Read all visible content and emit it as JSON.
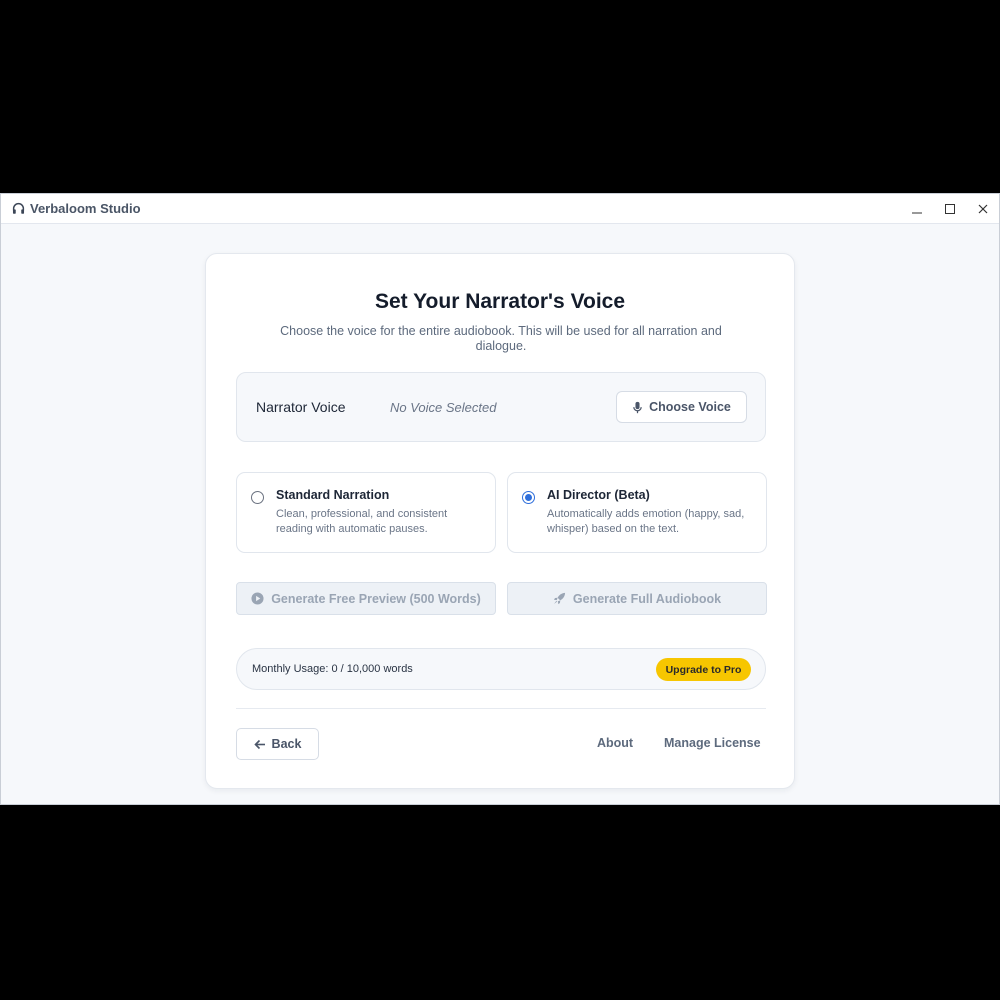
{
  "window": {
    "title": "Verbaloom Studio",
    "app_icon": "headphones-icon",
    "controls": {
      "minimize_icon": "minimize-icon",
      "maximize_icon": "maximize-icon",
      "close_icon": "close-icon"
    }
  },
  "page": {
    "heading": "Set Your Narrator's Voice",
    "subheading": "Choose the voice for the entire audiobook. This will be used for all narration and dialogue."
  },
  "narrator": {
    "label": "Narrator Voice",
    "value": "No Voice Selected",
    "choose_label": "Choose Voice",
    "choose_icon": "microphone-icon"
  },
  "modes": [
    {
      "title": "Standard Narration",
      "description": "Clean, professional, and consistent reading with automatic pauses.",
      "selected": false
    },
    {
      "title": "AI Director (Beta)",
      "description": "Automatically adds emotion (happy, sad, whisper) based on the text.",
      "selected": true
    }
  ],
  "actions": {
    "preview_label": "Generate Free Preview (500 Words)",
    "preview_icon": "play-circle-icon",
    "full_label": "Generate Full Audiobook",
    "full_icon": "rocket-icon"
  },
  "usage": {
    "text": "Monthly Usage: 0 / 10,000 words",
    "upgrade_label": "Upgrade to Pro"
  },
  "footer": {
    "back_label": "Back",
    "back_icon": "arrow-left-icon",
    "about_label": "About",
    "license_label": "Manage License"
  },
  "colors": {
    "accent": "#2f6fdb",
    "upgrade": "#f7c600",
    "heading": "#141c2b"
  }
}
